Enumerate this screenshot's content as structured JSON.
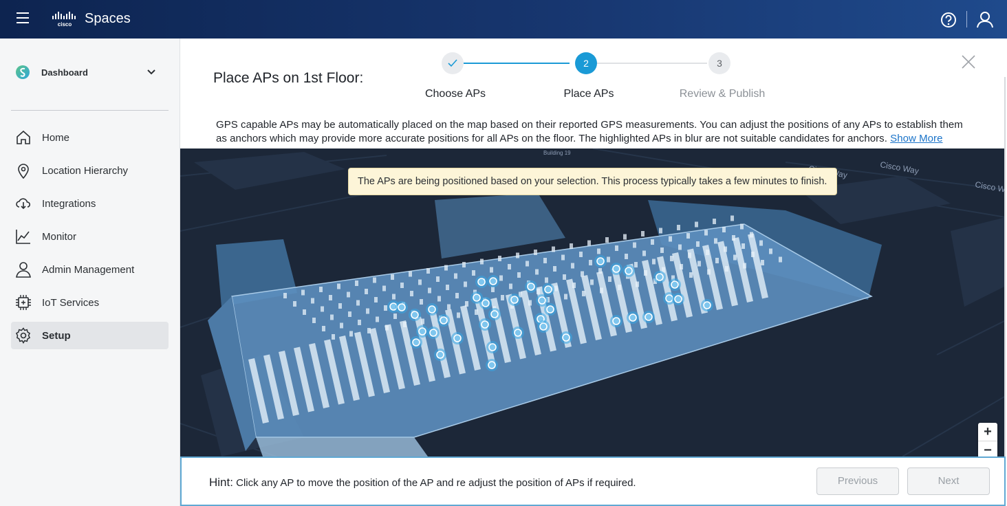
{
  "header": {
    "brand": "Spaces",
    "colors": {
      "bar": "#17366f",
      "accent": "#1a9ad6"
    },
    "icons": [
      "menu-icon",
      "cisco-logo",
      "help-icon",
      "user-icon"
    ]
  },
  "sidebar": {
    "dashboard_label": "Dashboard",
    "items": [
      {
        "label": "Home",
        "icon": "home-icon"
      },
      {
        "label": "Location Hierarchy",
        "icon": "location-pin-icon"
      },
      {
        "label": "Integrations",
        "icon": "cloud-integration-icon"
      },
      {
        "label": "Monitor",
        "icon": "chart-line-icon"
      },
      {
        "label": "Admin Management",
        "icon": "person-icon"
      },
      {
        "label": "IoT Services",
        "icon": "chip-icon"
      },
      {
        "label": "Setup",
        "icon": "gear-icon",
        "active": true
      }
    ]
  },
  "main": {
    "title": "Place APs on 1st Floor:",
    "steps": [
      {
        "number": "1",
        "label": "Choose APs",
        "state": "completed"
      },
      {
        "number": "2",
        "label": "Place APs",
        "state": "active"
      },
      {
        "number": "3",
        "label": "Review & Publish",
        "state": "pending"
      }
    ],
    "description": "GPS capable APs may be automatically placed on the map based on their reported GPS measurements. You can adjust the positions of any APs to establish them as anchors which may provide more accurate positions for all APs on the floor. The highlighted APs in blur are not suitable candidates for anchors.",
    "show_more": "Show More",
    "map": {
      "toast": "The APs are being positioned based on your selection. This process typically takes a few minutes to finish.",
      "street_labels": [
        "Cisco Way",
        "Cisco Way",
        "Cisco W"
      ],
      "building_label": "Building 19",
      "zoom_in": "+",
      "zoom_out": "−"
    },
    "footer": {
      "hint_label": "Hint:",
      "hint_text": "Click any AP to move the position of the AP and re adjust the position of APs if required.",
      "previous": "Previous",
      "next": "Next"
    }
  }
}
